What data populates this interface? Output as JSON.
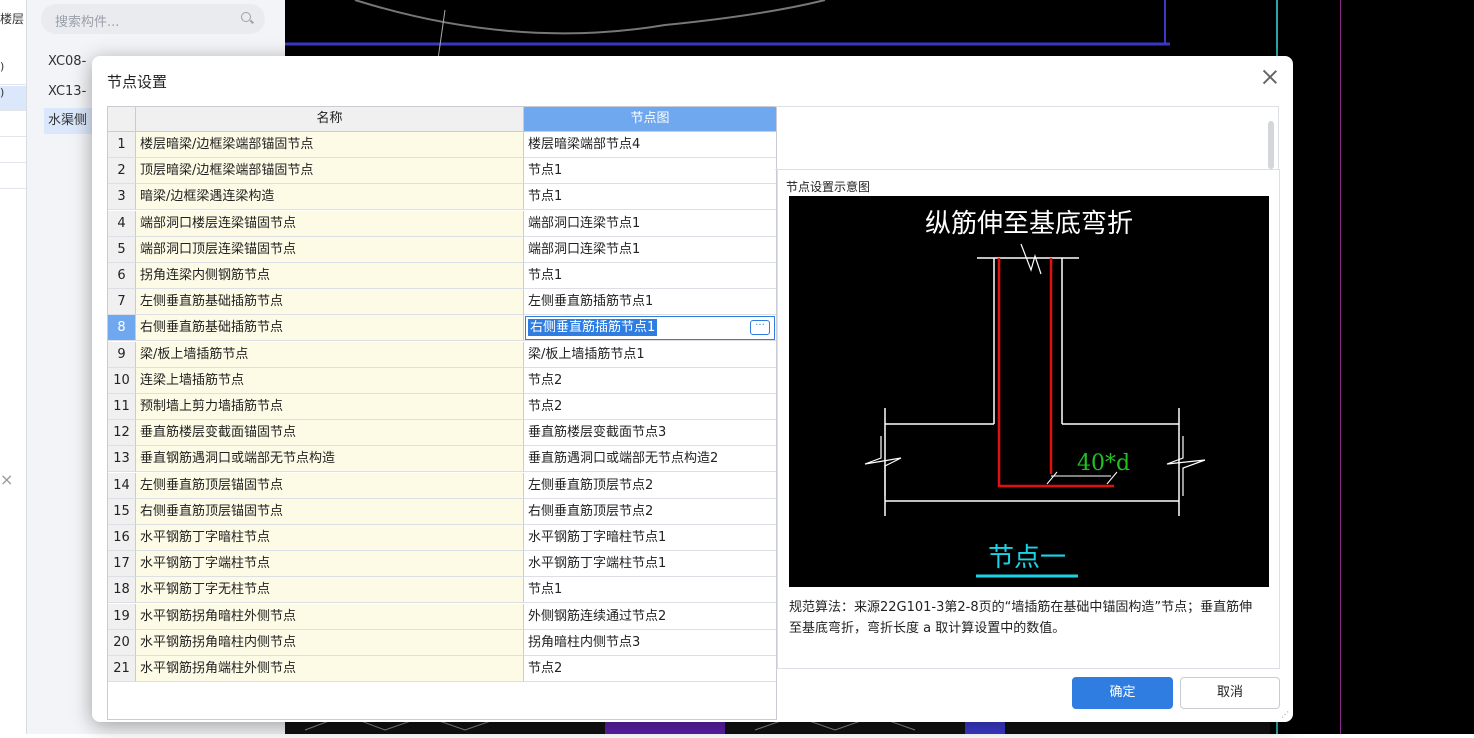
{
  "background": {
    "left_label": "楼层",
    "search_placeholder": "搜索构件...",
    "list_items": [
      "XC08-",
      "XC13-",
      "水渠侧"
    ],
    "left_rows": [
      ")",
      ")"
    ]
  },
  "dialog": {
    "title": "节点设置",
    "columns": {
      "name": "名称",
      "node": "节点图"
    },
    "rows": [
      {
        "idx": "1",
        "name": "楼层暗梁/边框梁端部锚固节点",
        "node": "楼层暗梁端部节点4"
      },
      {
        "idx": "2",
        "name": "顶层暗梁/边框梁端部锚固节点",
        "node": "节点1"
      },
      {
        "idx": "3",
        "name": "暗梁/边框梁遇连梁构造",
        "node": "节点1"
      },
      {
        "idx": "4",
        "name": "端部洞口楼层连梁锚固节点",
        "node": "端部洞口连梁节点1"
      },
      {
        "idx": "5",
        "name": "端部洞口顶层连梁锚固节点",
        "node": "端部洞口连梁节点1"
      },
      {
        "idx": "6",
        "name": "拐角连梁内侧钢筋节点",
        "node": "节点1"
      },
      {
        "idx": "7",
        "name": "左侧垂直筋基础插筋节点",
        "node": "左侧垂直筋插筋节点1"
      },
      {
        "idx": "8",
        "name": "右侧垂直筋基础插筋节点",
        "node": "右侧垂直筋插筋节点1"
      },
      {
        "idx": "9",
        "name": "梁/板上墙插筋节点",
        "node": "梁/板上墙插筋节点1"
      },
      {
        "idx": "10",
        "name": "连梁上墙插筋节点",
        "node": "节点2"
      },
      {
        "idx": "11",
        "name": "预制墙上剪力墙插筋节点",
        "node": "节点2"
      },
      {
        "idx": "12",
        "name": "垂直筋楼层变截面锚固节点",
        "node": "垂直筋楼层变截面节点3"
      },
      {
        "idx": "13",
        "name": "垂直钢筋遇洞口或端部无节点构造",
        "node": "垂直筋遇洞口或端部无节点构造2"
      },
      {
        "idx": "14",
        "name": "左侧垂直筋顶层锚固节点",
        "node": "左侧垂直筋顶层节点2"
      },
      {
        "idx": "15",
        "name": "右侧垂直筋顶层锚固节点",
        "node": "右侧垂直筋顶层节点2"
      },
      {
        "idx": "16",
        "name": "水平钢筋丁字暗柱节点",
        "node": "水平钢筋丁字暗柱节点1"
      },
      {
        "idx": "17",
        "name": "水平钢筋丁字端柱节点",
        "node": "水平钢筋丁字端柱节点1"
      },
      {
        "idx": "18",
        "name": "水平钢筋丁字无柱节点",
        "node": "节点1"
      },
      {
        "idx": "19",
        "name": "水平钢筋拐角暗柱外侧节点",
        "node": "外侧钢筋连续通过节点2"
      },
      {
        "idx": "20",
        "name": "水平钢筋拐角暗柱内侧节点",
        "node": "拐角暗柱内侧节点3"
      },
      {
        "idx": "21",
        "name": "水平钢筋拐角端柱外侧节点",
        "node": "节点2"
      }
    ],
    "selected_row": "8",
    "ellipsis": "···",
    "preview": {
      "title": "节点设置示意图",
      "image_heading": "纵筋伸至基底弯折",
      "image_dimension": "40*d",
      "image_caption": "节点一",
      "description": "规范算法：来源22G101-3第2-8页的“墙插筋在基础中锚固构造”节点；垂直筋伸至基底弯折，弯折长度 a 取计算设置中的数值。"
    },
    "ok_label": "确定",
    "cancel_label": "取消",
    "colors": {
      "accent": "#2f7de1",
      "header_blue": "#6fa8ef",
      "name_cell": "#fdfbe6",
      "rebar_red": "#e01010",
      "dim_green": "#22c022",
      "caption_cyan": "#19d3e6"
    }
  }
}
